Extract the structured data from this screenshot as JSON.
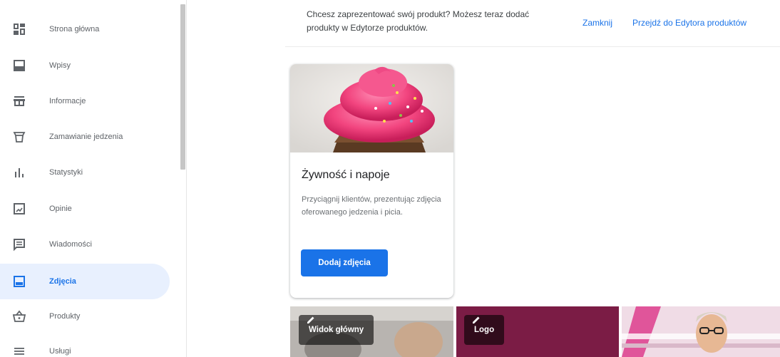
{
  "sidebar": {
    "items": [
      {
        "label": "Strona główna",
        "icon": "dashboard-icon"
      },
      {
        "label": "Wpisy",
        "icon": "posts-icon"
      },
      {
        "label": "Informacje",
        "icon": "storefront-icon"
      },
      {
        "label": "Zamawianie jedzenia",
        "icon": "food-order-icon"
      },
      {
        "label": "Statystyki",
        "icon": "bar-chart-icon"
      },
      {
        "label": "Opinie",
        "icon": "reviews-icon"
      },
      {
        "label": "Wiadomości",
        "icon": "messages-icon"
      },
      {
        "label": "Zdjęcia",
        "icon": "photos-icon",
        "active": true
      },
      {
        "label": "Produkty",
        "icon": "basket-icon"
      },
      {
        "label": "Usługi",
        "icon": "list-icon"
      }
    ]
  },
  "banner": {
    "text": "Chcesz zaprezentować swój produkt? Możesz teraz dodać produkty w Edytorze produktów.",
    "close_label": "Zamknij",
    "editor_label": "Przejdź do Edytora produktów"
  },
  "card": {
    "title": "Żywność i napoje",
    "description": "Przyciągnij klientów, prezentując zdjęcia oferowanego jedzenia i picia.",
    "button_label": "Dodaj zdjęcia"
  },
  "tiles": [
    {
      "label": "Widok główny"
    },
    {
      "label": "Logo"
    },
    {
      "label": ""
    }
  ],
  "colors": {
    "accent": "#1a73e8",
    "active_bg": "#e8f0fe",
    "logo_tile": "#7b1c45"
  }
}
